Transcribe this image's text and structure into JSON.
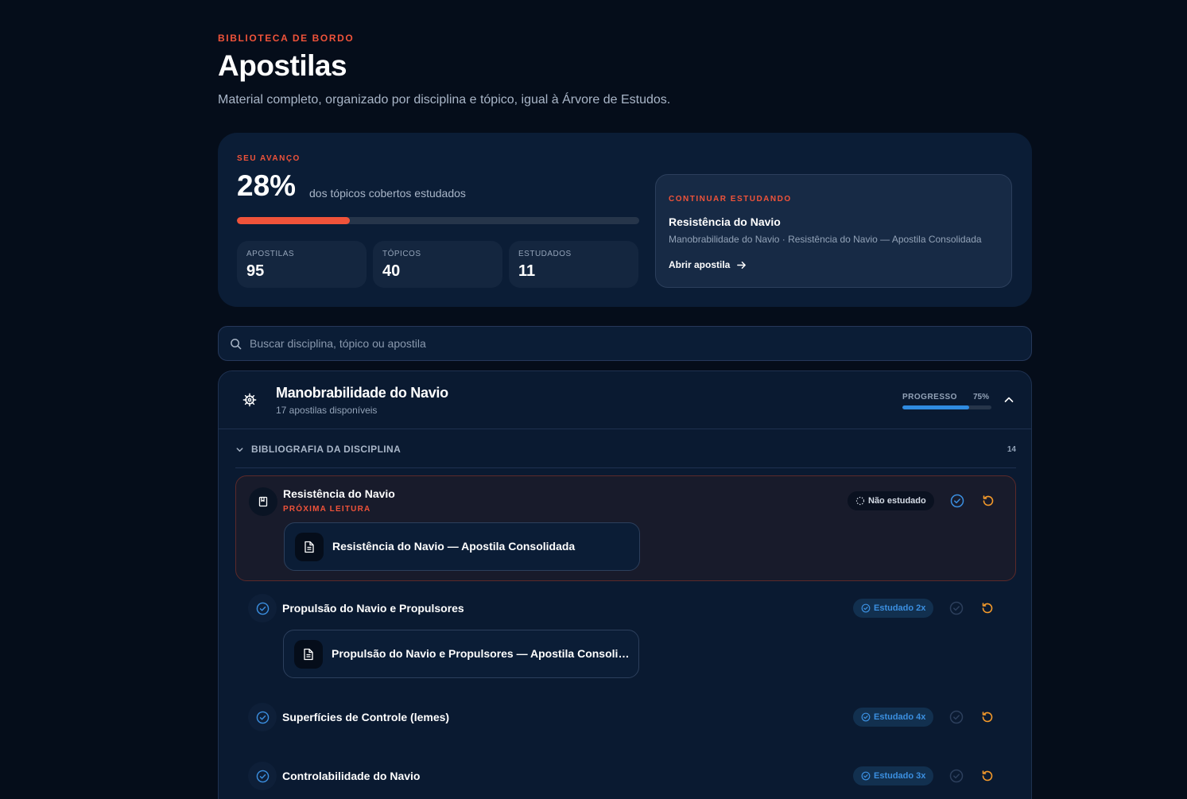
{
  "header": {
    "eyebrow": "BIBLIOTECA DE BORDO",
    "title": "Apostilas",
    "subtitle": "Material completo, organizado por disciplina e tópico, igual à Árvore de Estudos."
  },
  "progress": {
    "eyebrow": "SEU AVANÇO",
    "percent_label": "28%",
    "percent_value": 0.28,
    "caption": "dos tópicos cobertos estudados",
    "accent_color": "#f0533a",
    "stats": [
      {
        "label": "APOSTILAS",
        "value": "95"
      },
      {
        "label": "TÓPICOS",
        "value": "40"
      },
      {
        "label": "ESTUDADOS",
        "value": "11"
      }
    ]
  },
  "continue": {
    "eyebrow": "CONTINUAR ESTUDANDO",
    "title": "Resistência do Navio",
    "path": "Manobrabilidade do Navio · Resistência do Navio — Apostila Consolidada",
    "link_label": "Abrir apostila"
  },
  "search": {
    "placeholder": "Buscar disciplina, tópico ou apostila",
    "icon": "search-icon"
  },
  "discipline": {
    "icon": "ship-wheel-icon",
    "title": "Manobrabilidade do Navio",
    "subtitle": "17 apostilas disponíveis",
    "progress_label": "PROGRESSO",
    "progress_pct_label": "75%",
    "progress_value": 0.75,
    "progress_color": "#2f8be0",
    "section": {
      "title": "BIBLIOGRAFIA DA DISCIPLINA",
      "count": "14"
    },
    "topics": [
      {
        "title": "Resistência do Navio",
        "next_label": "PRÓXIMA LEITURA",
        "status": "Não estudado",
        "doc": "Resistência do Navio — Apostila Consolidada"
      },
      {
        "title": "Propulsão do Navio e Propulsores",
        "status": "Estudado 2x",
        "doc": "Propulsão do Navio e Propulsores — Apostila Consolidada"
      },
      {
        "title": "Superfícies de Controle (lemes)",
        "status": "Estudado 4x"
      },
      {
        "title": "Controlabilidade do Navio",
        "status": "Estudado 3x"
      }
    ]
  }
}
